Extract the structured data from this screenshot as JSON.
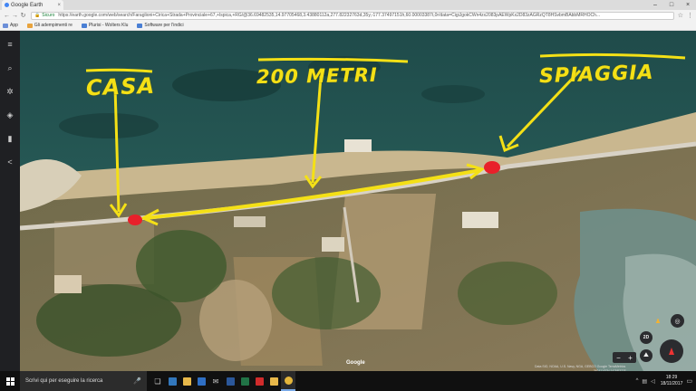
{
  "browser": {
    "tab_title": "Google Earth",
    "tab_close": "×",
    "window_controls": {
      "minimize": "–",
      "maximize": "□",
      "close": "×"
    },
    "nav": {
      "back": "←",
      "forward": "→",
      "reload": "↻"
    },
    "secure_label": "Sicuro",
    "url": "https://earth.google.com/web/search/Faraglioni+Cirica+Strada+Provinciale+67,+Ispica,+RG/@36.69482535,14.97705468,3.43880112a,277.82232763d,35y,-177.37497151h,60.00003387t,0r/data=CigiJgokCWn4zx2083pAEWpKx2D83zAGRzQT8HSvbmBAbbMRHOCh...",
    "bookmarks": [
      {
        "label": "App"
      },
      {
        "label": "Gli adempimenti re"
      },
      {
        "label": "Plurisi - Wolters Klu"
      },
      {
        "label": "Software per l'indici"
      }
    ]
  },
  "sidebar": {
    "items": [
      {
        "name": "menu",
        "glyph": "≡"
      },
      {
        "name": "search",
        "glyph": "⌕"
      },
      {
        "name": "voyager",
        "glyph": "✲"
      },
      {
        "name": "feeling-lucky",
        "glyph": "◈"
      },
      {
        "name": "projects",
        "glyph": "▮"
      },
      {
        "name": "share",
        "glyph": "<"
      }
    ]
  },
  "annotations": {
    "casa": "CASA",
    "metri": "200 METRI",
    "spiaggia": "SPIAGGIA"
  },
  "annotation_color": "#f4e016",
  "marker_color": "#e8202a",
  "map_controls": {
    "btn_2d": "2D",
    "zoom_out": "−",
    "zoom_in": "+",
    "google_logo": "Google",
    "attribution": "Data SIO, NOAA, U.S. Navy, NGA, GEBCO   Google   TerraMetrics",
    "coords": "36°41'43\"N 14°58'37\"E"
  },
  "taskbar": {
    "search_placeholder": "Scrivi qui per eseguire la ricerca",
    "mic": "🎤",
    "apps": [
      {
        "name": "task-view",
        "glyph": "❏"
      },
      {
        "name": "edge",
        "glyph": "e",
        "color": "#3277bc"
      },
      {
        "name": "file-explorer",
        "glyph": "",
        "color": "#e8b84a"
      },
      {
        "name": "store",
        "glyph": "",
        "color": "#2f6fc4"
      },
      {
        "name": "mail",
        "glyph": "✉",
        "color": "#ccc"
      },
      {
        "name": "word",
        "glyph": "W",
        "color": "#2b579a"
      },
      {
        "name": "excel",
        "glyph": "X",
        "color": "#217346"
      },
      {
        "name": "acrobat",
        "glyph": "A",
        "color": "#d12b2b"
      },
      {
        "name": "explorer2",
        "glyph": "",
        "color": "#e8b84a"
      },
      {
        "name": "chrome",
        "glyph": "◉",
        "color": "#e4b63b"
      }
    ],
    "time": "18:29",
    "date": "18/11/2017"
  }
}
